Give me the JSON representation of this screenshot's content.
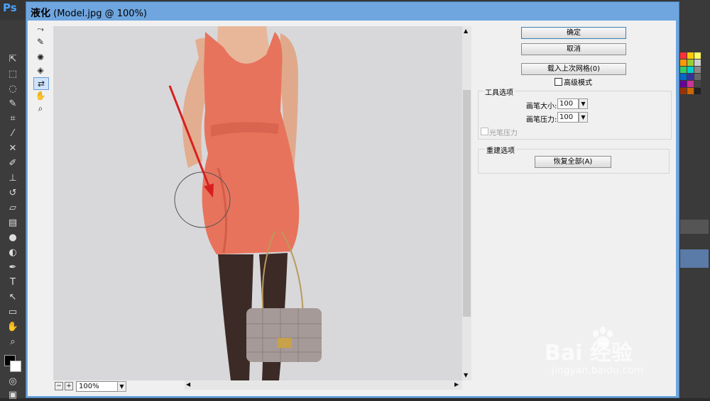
{
  "app": {
    "logo": "Ps"
  },
  "dialog": {
    "title_main": "液化",
    "title_sub": "(Model.jpg @ 100%)",
    "close_label": "✕"
  },
  "buttons": {
    "ok": "确定",
    "cancel": "取消",
    "load_mesh": "载入上次网格(0)",
    "restore_all": "恢复全部(A)"
  },
  "advanced_mode": {
    "label": "高级模式",
    "checked": false
  },
  "tool_options": {
    "group_label": "工具选项",
    "brush_size_label": "画笔大小:",
    "brush_size_value": "100",
    "brush_pressure_label": "画笔压力:",
    "brush_pressure_value": "100",
    "stylus_pressure_label": "光笔压力"
  },
  "reconstruct_options": {
    "group_label": "重建选项"
  },
  "zoom": {
    "value": "100%"
  },
  "icons": {
    "forward_warp": "forward-warp-icon",
    "reconstruct": "reconstruct-icon",
    "pucker": "pucker-icon",
    "bloat": "bloat-icon",
    "push_left": "push-left-icon",
    "hand": "hand-icon",
    "zoom": "zoom-icon"
  },
  "colors": {
    "dialog_frame": "#6fa6df",
    "dress": "#e8735c",
    "annotation_arrow": "#d62020",
    "canvas_bg": "#d8d8da"
  },
  "watermark": {
    "brand": "Bai 经验",
    "url": "jingyan.baidu.com"
  }
}
